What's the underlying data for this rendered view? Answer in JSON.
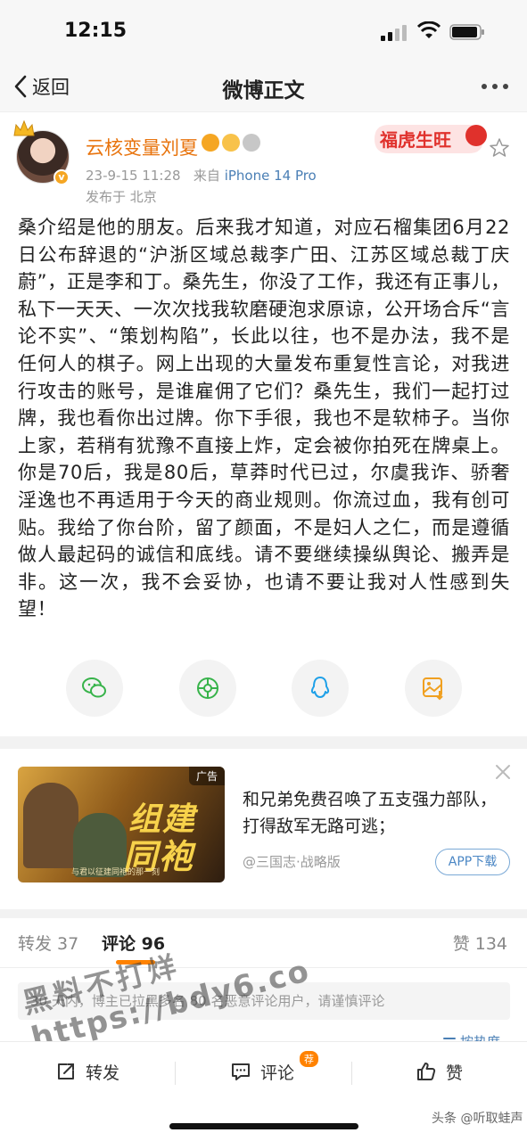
{
  "status_bar": {
    "time": "12:15"
  },
  "nav": {
    "back_label": "返回",
    "title": "微博正文"
  },
  "post": {
    "username": "云核变量刘夏",
    "timestamp": "23-9-15 11:28",
    "source_prefix": "来自",
    "device": "iPhone 14 Pro",
    "location": "发布于 北京",
    "festival_badge": "福虎生旺",
    "body": "桑介绍是他的朋友。后来我才知道，对应石榴集团6月22日公布辞退的“沪浙区域总裁李广田、江苏区域总裁丁庆蔚”，正是李和丁。桑先生，你没了工作，我还有正事儿，私下一天天、一次次找我软磨硬泡求原谅，公开场合斥“言论不实”、“策划构陷”，长此以往，也不是办法，我不是任何人的棋子。网上出现的大量发布重复性言论，对我进行攻击的账号，是谁雇佣了它们？桑先生，我们一起打过牌，我也看你出过牌。你下手很，我也不是软柿子。当你上家，若稍有犹豫不直接上炸，定会被你拍死在牌桌上。你是70后，我是80后，草莽时代已过，尔虞我诈、骄奢淫逸也不再适用于今天的商业规则。你流过血，我有创可贴。我给了你台阶，留了颜面，不是妇人之仁，而是遵循做人最起码的诚信和底线。请不要继续操纵舆论、搬弄是非。这一次，我不会妥协，也请不要让我对人性感到失望！"
  },
  "share": [
    "wechat-icon",
    "moments-icon",
    "qq-icon",
    "save-image-icon"
  ],
  "ad": {
    "tag": "广告",
    "art_line1": "组建",
    "art_line2": "同袍",
    "caption": "与君以征建同袍的那一刻",
    "text": "和兄弟免费召唤了五支强力部队，打得敌军无路可逃；",
    "source": "@三国志·战略版",
    "download_label": "APP下载"
  },
  "tabs": {
    "repost": "转发 37",
    "comment": "评论 96",
    "like": "赞 134"
  },
  "notice": "30 天内，博主已拉黑多名 80 名恶意评论用户，请谨慎评论",
  "sort_label": "按热度",
  "bottom_bar": {
    "repost": "转发",
    "comment": "评论",
    "comment_badge": "荐",
    "like": "赞"
  },
  "watermark": {
    "line1": "黑料不打烊",
    "line2": "https://bdy6.co"
  },
  "source_credit": "头条 @听取蛙声",
  "colors": {
    "accent": "#ff8200",
    "username": "#e8730c",
    "link": "#4a7fb5"
  }
}
